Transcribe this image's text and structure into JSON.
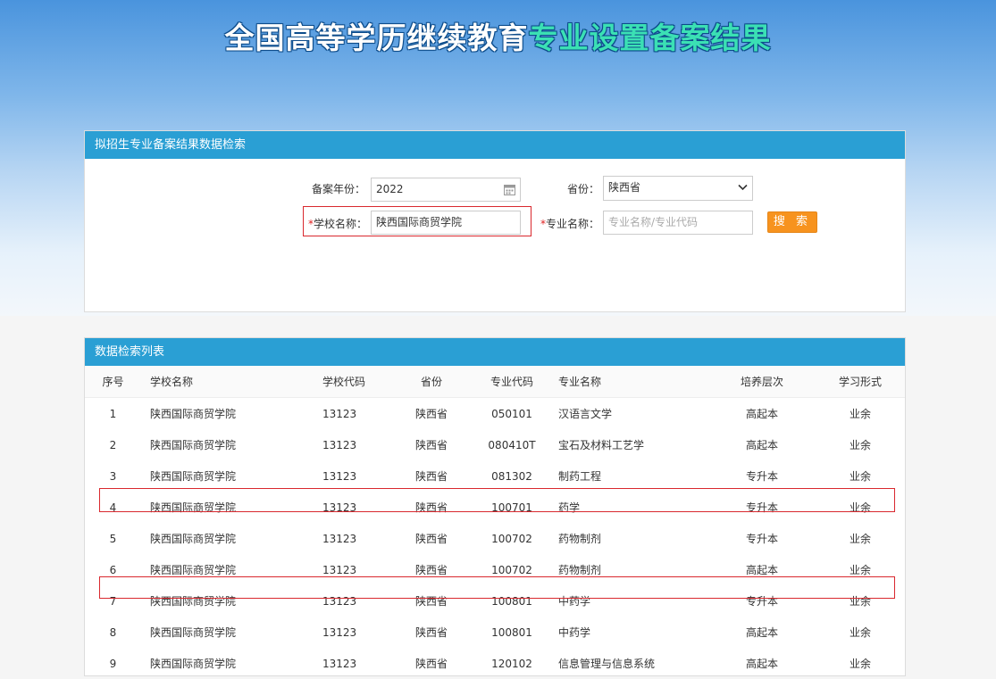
{
  "page": {
    "title_part1": "全国高等学历继续教育",
    "title_part2": "专业设置备案结果"
  },
  "search": {
    "panel_title": "拟招生专业备案结果数据检索",
    "year_label": "备案年份：",
    "year_value": "2022",
    "province_label": "省份：",
    "province_value": "陕西省",
    "school_label_required": "*",
    "school_label": "学校名称：",
    "school_value": "陕西国际商贸学院",
    "major_label_required": "*",
    "major_label": "专业名称：",
    "major_placeholder": "专业名称/专业代码",
    "search_button": "搜 索"
  },
  "list": {
    "panel_title": "数据检索列表",
    "columns": [
      "序号",
      "学校名称",
      "学校代码",
      "省份",
      "专业代码",
      "专业名称",
      "培养层次",
      "学习形式"
    ],
    "rows": [
      [
        "1",
        "陕西国际商贸学院",
        "13123",
        "陕西省",
        "050101",
        "汉语言文学",
        "高起本",
        "业余"
      ],
      [
        "2",
        "陕西国际商贸学院",
        "13123",
        "陕西省",
        "080410T",
        "宝石及材料工艺学",
        "高起本",
        "业余"
      ],
      [
        "3",
        "陕西国际商贸学院",
        "13123",
        "陕西省",
        "081302",
        "制药工程",
        "专升本",
        "业余"
      ],
      [
        "4",
        "陕西国际商贸学院",
        "13123",
        "陕西省",
        "100701",
        "药学",
        "专升本",
        "业余"
      ],
      [
        "5",
        "陕西国际商贸学院",
        "13123",
        "陕西省",
        "100702",
        "药物制剂",
        "专升本",
        "业余"
      ],
      [
        "6",
        "陕西国际商贸学院",
        "13123",
        "陕西省",
        "100702",
        "药物制剂",
        "高起本",
        "业余"
      ],
      [
        "7",
        "陕西国际商贸学院",
        "13123",
        "陕西省",
        "100801",
        "中药学",
        "专升本",
        "业余"
      ],
      [
        "8",
        "陕西国际商贸学院",
        "13123",
        "陕西省",
        "100801",
        "中药学",
        "高起本",
        "业余"
      ],
      [
        "9",
        "陕西国际商贸学院",
        "13123",
        "陕西省",
        "120102",
        "信息管理与信息系统",
        "高起本",
        "业余"
      ]
    ]
  },
  "colors": {
    "header_blue": "#2a9fd4",
    "button_orange": "#f7931e",
    "highlight_red": "#d9282e"
  }
}
